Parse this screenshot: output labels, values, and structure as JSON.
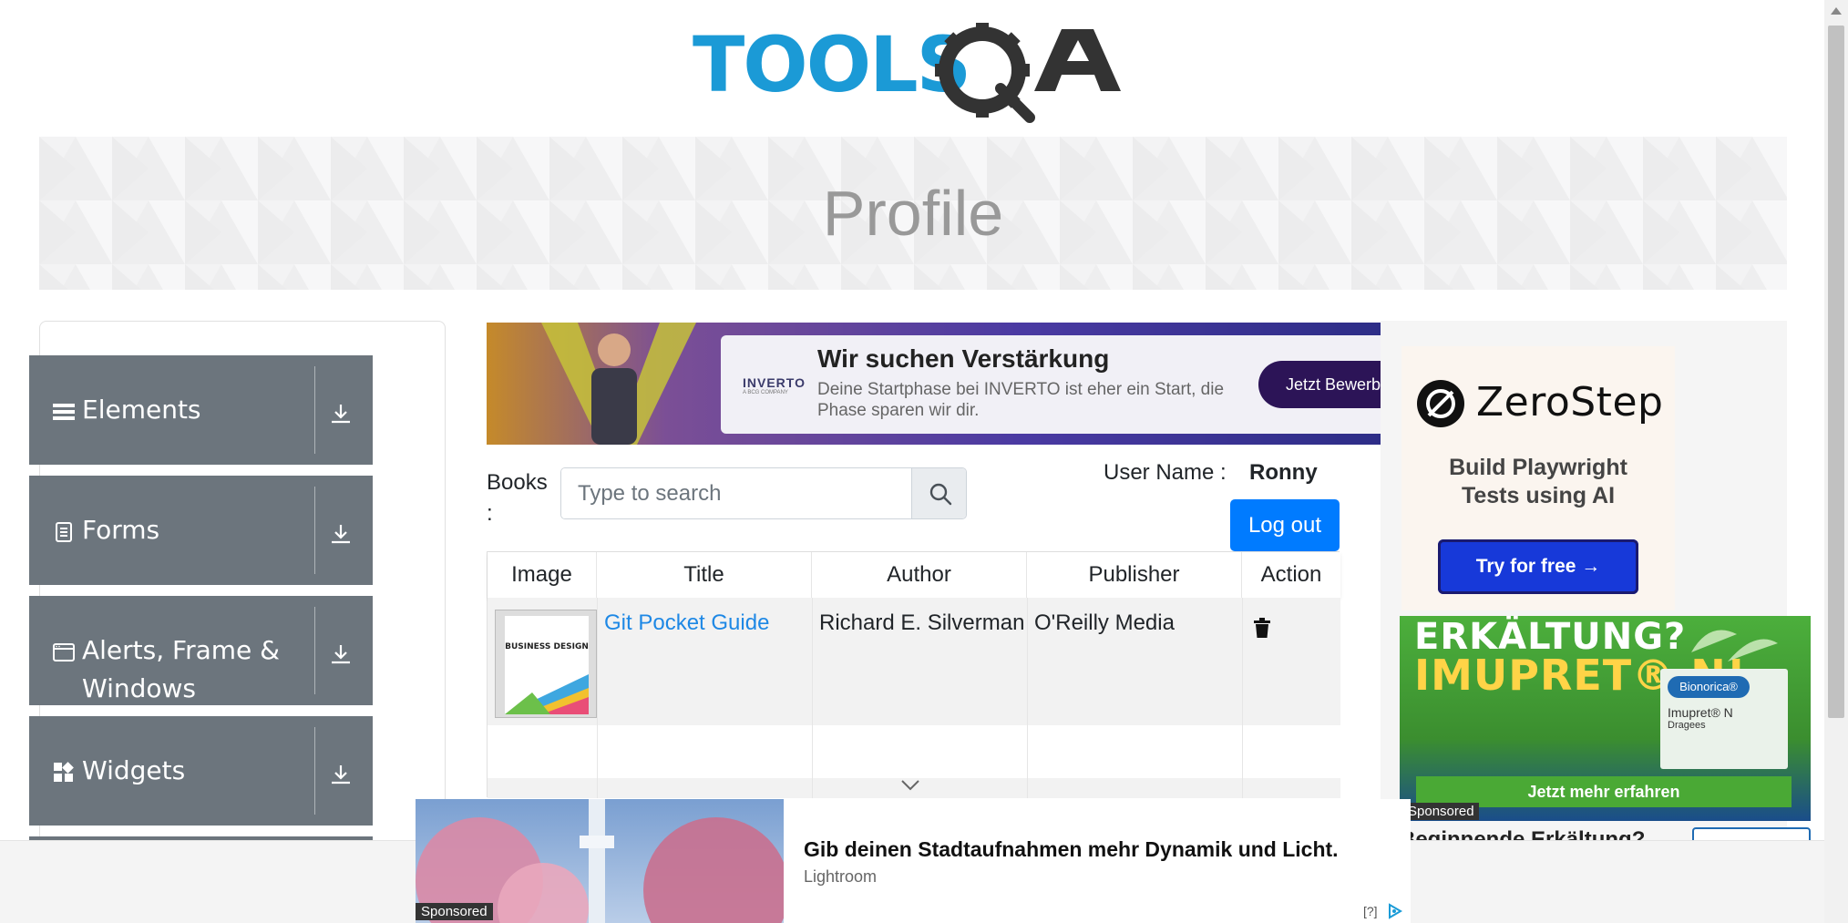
{
  "header": {
    "logo_text": "TOOLSQA"
  },
  "banner": {
    "title": "Profile"
  },
  "left_menu": {
    "groups": [
      {
        "label": "Elements",
        "icon": "hamburger-icon"
      },
      {
        "label": "Forms",
        "icon": "document-icon"
      },
      {
        "label": "Alerts, Frame &",
        "label_line2": "Windows",
        "icon": "window-icon"
      },
      {
        "label": "Widgets",
        "icon": "widgets-icon"
      }
    ]
  },
  "ad_top": {
    "brand": "INVERTO",
    "brand_sub": "A BCG COMPANY",
    "headline": "Wir suchen Verstärkung",
    "sub": "Deine Startphase bei INVERTO ist eher ein Start, die Phase sparen wir dir.",
    "cta": "Jetzt Bewerben"
  },
  "books": {
    "label": "Books :",
    "search_placeholder": "Type to search"
  },
  "user": {
    "label": "User Name :",
    "value": "Ronny",
    "logout": "Log out"
  },
  "table": {
    "headers": [
      "Image",
      "Title",
      "Author",
      "Publisher",
      "Action"
    ],
    "rows": [
      {
        "title": "Git Pocket Guide",
        "author": "Richard E. Silverman",
        "publisher": "O'Reilly Media",
        "cover_text": "BUSINESS DESIGN"
      }
    ]
  },
  "ad_zerostep": {
    "name": "ZeroStep",
    "tagline_1": "Build Playwright",
    "tagline_2": "Tests using AI",
    "cta": "Try for free →"
  },
  "ad_imupret": {
    "line1": "ERKÄLTUNG?",
    "line2": "IMUPRET® N!",
    "brand": "Bionorica®",
    "product": "Imupret® N",
    "product_sub": "Dragees",
    "cta": "Jetzt mehr erfahren",
    "sponsored": "Sponsored",
    "question": "Beginnende Erkältung?"
  },
  "ad_bottom": {
    "headline": "Gib deinen Stadtaufnahmen mehr Dynamik und Licht.",
    "source": "Lightroom",
    "sponsored": "Sponsored",
    "help": "[?]"
  },
  "colors": {
    "menu_bg": "#6c757d",
    "primary": "#007bff",
    "link": "#1e88e5",
    "logo_blue": "#1b9ad6",
    "logo_dark": "#333333"
  }
}
